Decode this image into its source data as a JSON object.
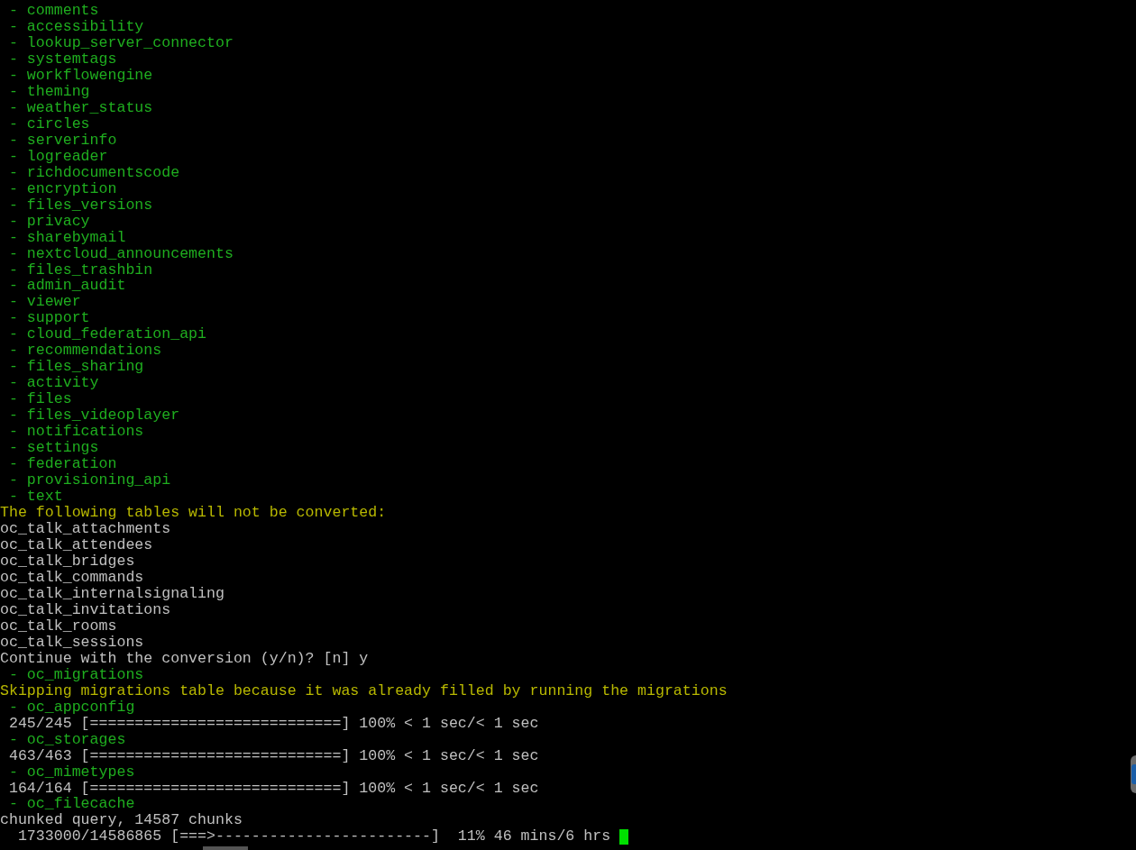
{
  "terminal": {
    "cursor_visible": true,
    "lines": [
      {
        "kind": "item",
        "text": " - comments"
      },
      {
        "kind": "item",
        "text": " - accessibility"
      },
      {
        "kind": "item",
        "text": " - lookup_server_connector"
      },
      {
        "kind": "item",
        "text": " - systemtags"
      },
      {
        "kind": "item",
        "text": " - workflowengine"
      },
      {
        "kind": "item",
        "text": " - theming"
      },
      {
        "kind": "item",
        "text": " - weather_status"
      },
      {
        "kind": "item",
        "text": " - circles"
      },
      {
        "kind": "item",
        "text": " - serverinfo"
      },
      {
        "kind": "item",
        "text": " - logreader"
      },
      {
        "kind": "item",
        "text": " - richdocumentscode"
      },
      {
        "kind": "item",
        "text": " - encryption"
      },
      {
        "kind": "item",
        "text": " - files_versions"
      },
      {
        "kind": "item",
        "text": " - privacy"
      },
      {
        "kind": "item",
        "text": " - sharebymail"
      },
      {
        "kind": "item",
        "text": " - nextcloud_announcements"
      },
      {
        "kind": "item",
        "text": " - files_trashbin"
      },
      {
        "kind": "item",
        "text": " - admin_audit"
      },
      {
        "kind": "item",
        "text": " - viewer"
      },
      {
        "kind": "item",
        "text": " - support"
      },
      {
        "kind": "item",
        "text": " - cloud_federation_api"
      },
      {
        "kind": "item",
        "text": " - recommendations"
      },
      {
        "kind": "item",
        "text": " - files_sharing"
      },
      {
        "kind": "item",
        "text": " - activity"
      },
      {
        "kind": "item",
        "text": " - files"
      },
      {
        "kind": "item",
        "text": " - files_videoplayer"
      },
      {
        "kind": "item",
        "text": " - notifications"
      },
      {
        "kind": "item",
        "text": " - settings"
      },
      {
        "kind": "item",
        "text": " - federation"
      },
      {
        "kind": "item",
        "text": " - provisioning_api"
      },
      {
        "kind": "item",
        "text": " - text"
      },
      {
        "kind": "notice",
        "text": "The following tables will not be converted:"
      },
      {
        "kind": "output",
        "text": "oc_talk_attachments"
      },
      {
        "kind": "output",
        "text": "oc_talk_attendees"
      },
      {
        "kind": "output",
        "text": "oc_talk_bridges"
      },
      {
        "kind": "output",
        "text": "oc_talk_commands"
      },
      {
        "kind": "output",
        "text": "oc_talk_internalsignaling"
      },
      {
        "kind": "output",
        "text": "oc_talk_invitations"
      },
      {
        "kind": "output",
        "text": "oc_talk_rooms"
      },
      {
        "kind": "output",
        "text": "oc_talk_sessions"
      },
      {
        "kind": "output",
        "text": "Continue with the conversion (y/n)? [n] y"
      },
      {
        "kind": "item",
        "text": " - oc_migrations"
      },
      {
        "kind": "notice",
        "text": "Skipping migrations table because it was already filled by running the migrations"
      },
      {
        "kind": "item",
        "text": " - oc_appconfig"
      },
      {
        "kind": "output",
        "text": " 245/245 [============================] 100% < 1 sec/< 1 sec"
      },
      {
        "kind": "item",
        "text": " - oc_storages"
      },
      {
        "kind": "output",
        "text": " 463/463 [============================] 100% < 1 sec/< 1 sec"
      },
      {
        "kind": "item",
        "text": " - oc_mimetypes"
      },
      {
        "kind": "output",
        "text": " 164/164 [============================] 100% < 1 sec/< 1 sec"
      },
      {
        "kind": "item",
        "text": " - oc_filecache"
      },
      {
        "kind": "output",
        "text": "chunked query, 14587 chunks"
      },
      {
        "kind": "output",
        "text": "  1733000/14586865 [===>------------------------]  11% 46 mins/6 hrs "
      }
    ]
  }
}
